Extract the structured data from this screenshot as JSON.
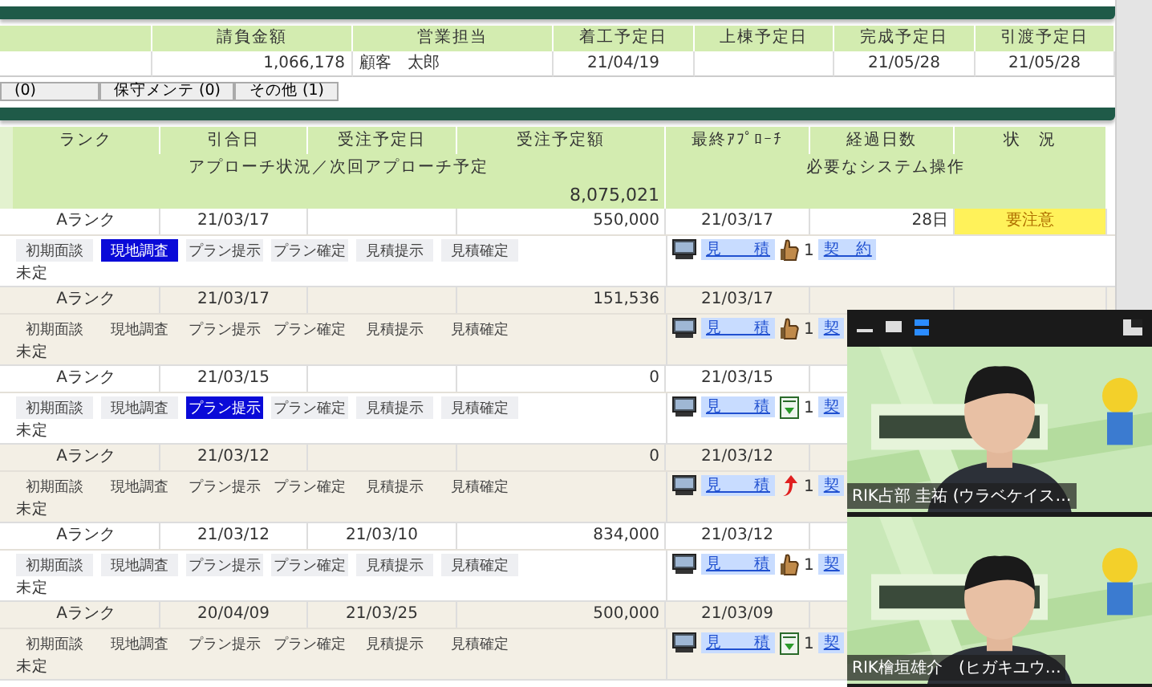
{
  "summary_table": {
    "columns": [
      {
        "label": "請負金額",
        "value": "1,066,178"
      },
      {
        "label": "営業担当",
        "value": "顧客　太郎"
      },
      {
        "label": "着工予定日",
        "value": "21/04/19"
      },
      {
        "label": "上棟予定日"
      },
      {
        "label": "完成予定日",
        "value": "21/05/28"
      },
      {
        "label": "引渡予定日",
        "value": "21/05/28"
      }
    ]
  },
  "tabs": [
    {
      "label": "(0)"
    },
    {
      "label": "保守メンテ (0)"
    },
    {
      "label": "その他 (1)"
    }
  ],
  "main_table": {
    "header_row_1": [
      "ランク",
      "引合日",
      "受注予定日",
      "受注予定額",
      "最終ｱﾌﾟﾛｰﾁ",
      "経過日数",
      "状　況"
    ],
    "header_row_2": [
      "アプローチ状況／次回アプローチ予定",
      "必要なシステム操作"
    ],
    "total": "8,075,021",
    "records": [
      {
        "rank": "Aランク",
        "inquiry_date": "21/03/17",
        "amount": "550,000",
        "last_approach": "21/03/17",
        "elapsed": "28日",
        "status": "要注意",
        "steps": [
          {
            "label": "初期面談",
            "selected": false
          },
          {
            "label": "現地調査",
            "selected": true
          },
          {
            "label": "プラン提示",
            "selected": false
          },
          {
            "label": "プラン確定",
            "selected": false
          },
          {
            "label": "見積提示",
            "selected": false
          },
          {
            "label": "見積確定",
            "selected": false
          }
        ],
        "note": "未定",
        "estimate": "見　　積",
        "reaction_icon": {
          "kind": "thumb"
        },
        "count": "1",
        "contract": "契　約"
      },
      {
        "rank": "Aランク",
        "inquiry_date": "21/03/17",
        "amount": "151,536",
        "last_approach": "21/03/17",
        "steps": [
          {
            "label": "初期面談",
            "selected": false
          },
          {
            "label": "現地調査",
            "selected": false
          },
          {
            "label": "プラン提示",
            "selected": false
          },
          {
            "label": "プラン確定",
            "selected": false
          },
          {
            "label": "見積提示",
            "selected": false
          },
          {
            "label": "見積確定",
            "selected": false
          }
        ],
        "note": "未定",
        "estimate": "見　　積",
        "reaction_icon": {
          "kind": "thumb"
        },
        "count": "1",
        "contract": "契"
      },
      {
        "rank": "Aランク",
        "inquiry_date": "21/03/15",
        "amount": "0",
        "last_approach": "21/03/15",
        "steps": [
          {
            "label": "初期面談",
            "selected": false
          },
          {
            "label": "現地調査",
            "selected": false
          },
          {
            "label": "プラン提示",
            "selected": true
          },
          {
            "label": "プラン確定",
            "selected": false
          },
          {
            "label": "見積提示",
            "selected": false
          },
          {
            "label": "見積確定",
            "selected": false
          }
        ],
        "note": "未定",
        "estimate": "見　　積",
        "reaction_icon": {
          "kind": "document"
        },
        "count": "1",
        "contract": "契"
      },
      {
        "rank": "Aランク",
        "inquiry_date": "21/03/12",
        "amount": "0",
        "last_approach": "21/03/12",
        "steps": [
          {
            "label": "初期面談",
            "selected": false
          },
          {
            "label": "現地調査",
            "selected": false
          },
          {
            "label": "プラン提示",
            "selected": false
          },
          {
            "label": "プラン確定",
            "selected": false
          },
          {
            "label": "見積提示",
            "selected": false
          },
          {
            "label": "見積確定",
            "selected": false
          }
        ],
        "note": "未定",
        "estimate": "見　　積",
        "reaction_icon": {
          "kind": "arrow"
        },
        "count": "1",
        "contract": "契"
      },
      {
        "rank": "Aランク",
        "inquiry_date": "21/03/12",
        "order_date": "21/03/10",
        "amount": "834,000",
        "last_approach": "21/03/12",
        "steps": [
          {
            "label": "初期面談",
            "selected": false
          },
          {
            "label": "現地調査",
            "selected": false
          },
          {
            "label": "プラン提示",
            "selected": false
          },
          {
            "label": "プラン確定",
            "selected": false
          },
          {
            "label": "見積提示",
            "selected": false
          },
          {
            "label": "見積確定",
            "selected": false
          }
        ],
        "note": "未定",
        "estimate": "見　　積",
        "reaction_icon": {
          "kind": "thumb"
        },
        "count": "1",
        "contract": "契"
      },
      {
        "rank": "Aランク",
        "inquiry_date": "20/04/09",
        "order_date": "21/03/25",
        "amount": "500,000",
        "last_approach": "21/03/09",
        "steps": [
          {
            "label": "初期面談",
            "selected": false
          },
          {
            "label": "現地調査",
            "selected": false
          },
          {
            "label": "プラン提示",
            "selected": false
          },
          {
            "label": "プラン確定",
            "selected": false
          },
          {
            "label": "見積提示",
            "selected": false
          },
          {
            "label": "見積確定",
            "selected": false
          }
        ],
        "note": "未定",
        "estimate": "見　　積",
        "reaction_icon": {
          "kind": "document"
        },
        "count": "1",
        "contract": "契"
      }
    ]
  },
  "video_call": {
    "participants": [
      {
        "name": "RIK占部 圭祐 (ウラベケイス…",
        "kind": "picture"
      },
      {
        "name": "RIK檜垣雄介　(ヒガキユウ…",
        "kind": "picture"
      }
    ]
  }
}
